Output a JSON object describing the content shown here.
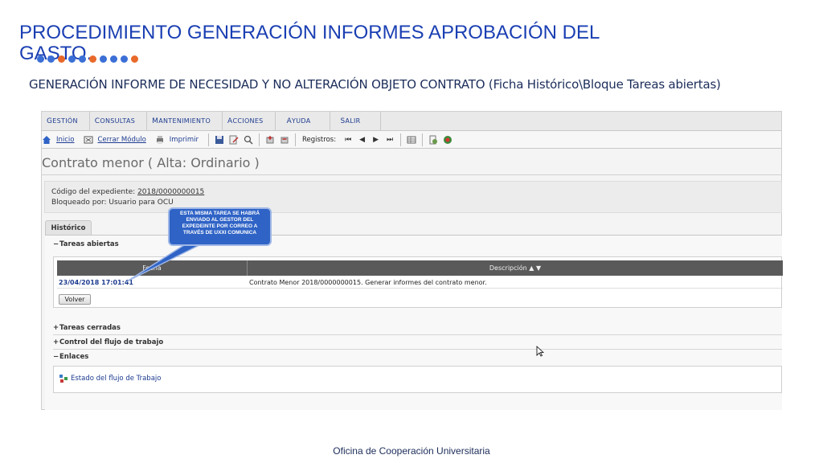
{
  "slide": {
    "title": "PROCEDIMIENTO GENERACIÓN INFORMES APROBACIÓN DEL GASTO.",
    "subtitle": "GENERACIÓN INFORME DE NECESIDAD Y NO ALTERACIÓN OBJETO CONTRATO (Ficha Histórico\\Bloque Tareas abiertas)",
    "footer": "Oficina de Cooperación Universitaria",
    "dot_colors": [
      "#3b6fd6",
      "#3b6fd6",
      "#e8692a",
      "#3b6fd6",
      "#3b6fd6",
      "#e8692a",
      "#3b6fd6",
      "#3b6fd6",
      "#3b6fd6",
      "#e8692a"
    ]
  },
  "app": {
    "menu": [
      "Gestión",
      "Consultas",
      "Mantenimiento",
      "Acciones",
      "Ayuda",
      "Salir"
    ],
    "toolbar": {
      "inicio": "Inicio",
      "cerrar_modulo": "Cerrar Módulo",
      "imprimir": "Imprimir",
      "registros": "Registros:"
    },
    "page_heading": "Contrato menor ( Alta: Ordinario )",
    "info": {
      "codigo_label": "Código del expediente: ",
      "codigo_value": "2018/0000000015",
      "bloqueado": "Bloqueado por: Usuario para OCU"
    },
    "tab": "Histórico",
    "sections": {
      "abiertas": "Tareas abiertas",
      "cerradas": "Tareas cerradas",
      "control": "Control del flujo de trabajo",
      "enlaces": "Enlaces"
    },
    "table": {
      "col_fecha": "Fecha",
      "col_descripcion": "Descripción ▲ ▼",
      "rows": [
        {
          "fecha": "23/04/2018 17:01:41",
          "descripcion": "Contrato Menor 2018/0000000015. Generar informes del contrato menor."
        }
      ]
    },
    "volver": "Volver",
    "enlace_estado": "Estado del flujo de Trabajo"
  },
  "callout": "ESTA MISMA TAREA SE HABRÁ ENVIADO AL GESTOR DEL EXPEDEINTE POR CORREO A TRAVÉS DE UXXI COMUNICA"
}
